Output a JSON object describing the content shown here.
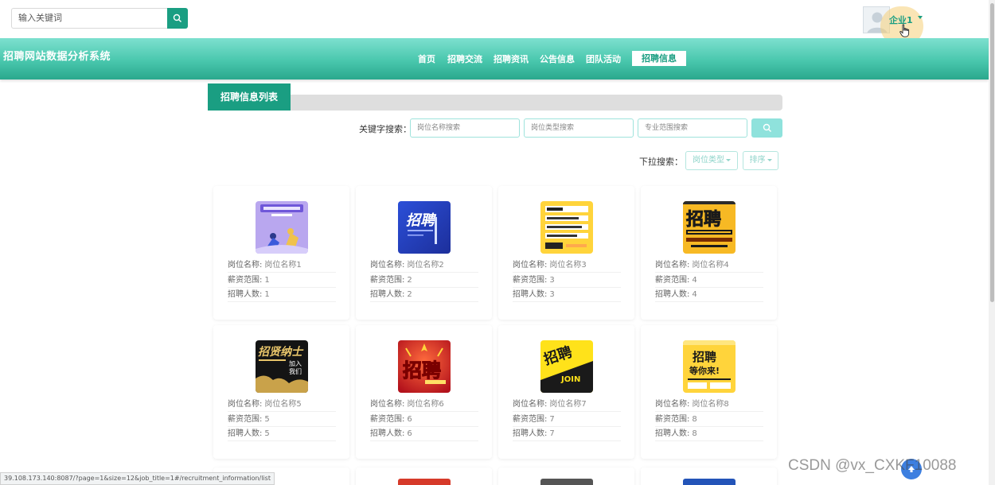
{
  "header": {
    "search_placeholder": "输入关键词",
    "user_name": "企业1"
  },
  "navbar": {
    "site_title": "招聘网站数据分析系统",
    "items": [
      "首页",
      "招聘交流",
      "招聘资讯",
      "公告信息",
      "团队活动"
    ],
    "active_item": "招聘信息"
  },
  "section": {
    "title": "招聘信息列表"
  },
  "filters": {
    "keyword_label": "关键字搜索：",
    "job_name_placeholder": "岗位名称搜索",
    "job_type_placeholder": "岗位类型搜索",
    "major_placeholder": "专业范围搜索",
    "dropdown_label": "下拉搜索：",
    "job_type_dropdown": "岗位类型",
    "sort_dropdown": "排序"
  },
  "field_labels": {
    "job_name": "岗位名称:",
    "salary": "薪资范围:",
    "headcount": "招聘人数:"
  },
  "cards": [
    {
      "job_name": "岗位名称1",
      "salary": "1",
      "headcount": "1"
    },
    {
      "job_name": "岗位名称2",
      "salary": "2",
      "headcount": "2"
    },
    {
      "job_name": "岗位名称3",
      "salary": "3",
      "headcount": "3"
    },
    {
      "job_name": "岗位名称4",
      "salary": "4",
      "headcount": "4"
    },
    {
      "job_name": "岗位名称5",
      "salary": "5",
      "headcount": "5"
    },
    {
      "job_name": "岗位名称6",
      "salary": "6",
      "headcount": "6"
    },
    {
      "job_name": "岗位名称7",
      "salary": "7",
      "headcount": "7"
    },
    {
      "job_name": "岗位名称8",
      "salary": "8",
      "headcount": "8"
    }
  ],
  "thumbnail_text": {
    "card2": "招聘",
    "card4": "招聘",
    "card5_line1": "招贤纳士",
    "card5_line2": "加入",
    "card5_line3": "我们",
    "card6": "招聘",
    "card7_main": "招聘",
    "card7_sub": "JOIN",
    "card8_line1": "招聘",
    "card8_line2": "等你来!"
  },
  "status_url": "39.108.173.140:8087/?page=1&size=12&job_title=1#/recruitment_information/list",
  "watermark": "CSDN @vx_CXKF10088",
  "colors": {
    "brand": "#1a9e82",
    "nav_gradient_top": "#7de0cf",
    "nav_gradient_bottom": "#2aa88d",
    "input_border": "#9fe3dc"
  }
}
